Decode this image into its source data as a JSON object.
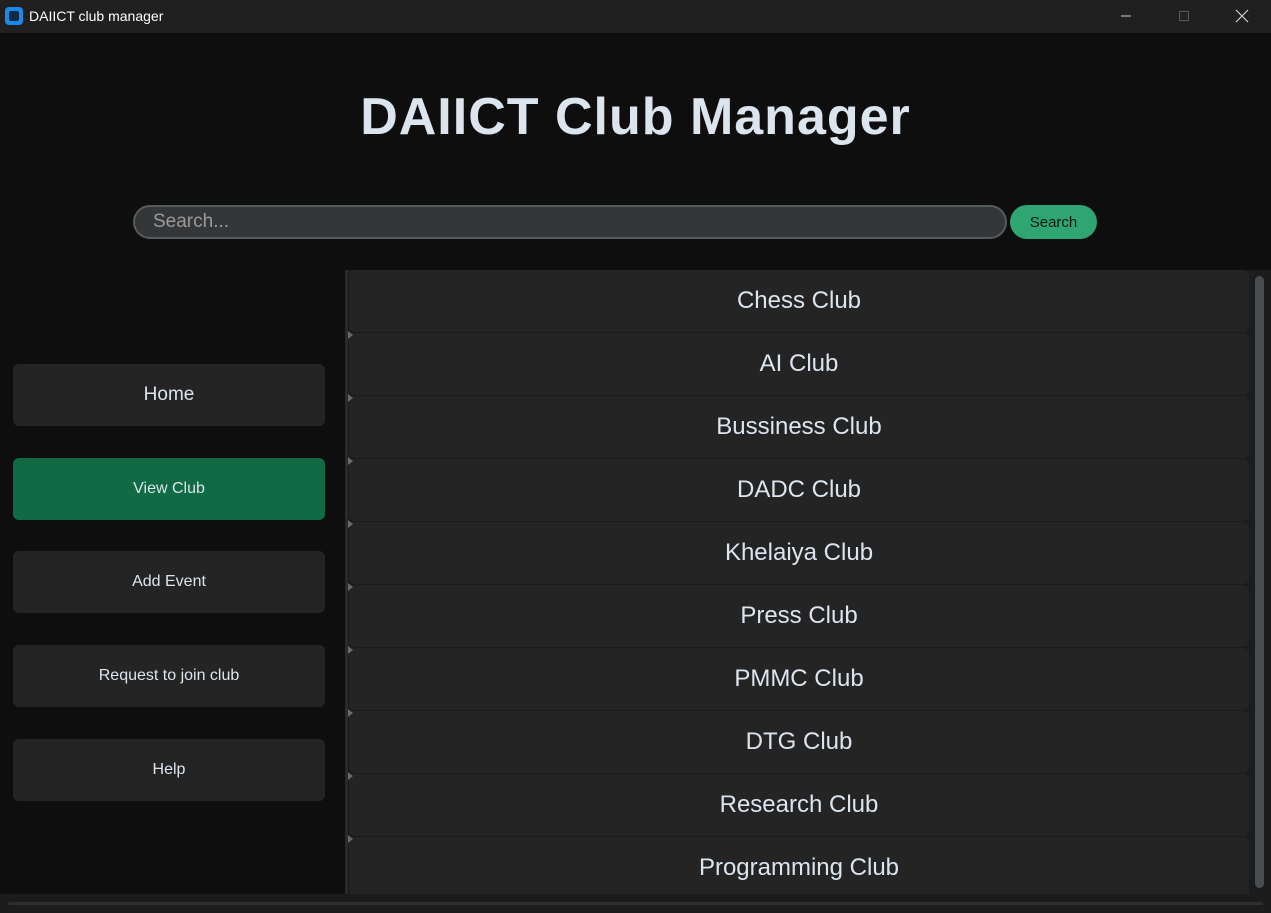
{
  "window": {
    "title": "DAIICT club manager"
  },
  "heading": "DAIICT Club Manager",
  "search": {
    "placeholder": "Search...",
    "value": "",
    "button_label": "Search"
  },
  "sidebar": {
    "items": [
      {
        "label": "Home",
        "active": false
      },
      {
        "label": "View Club",
        "active": true
      },
      {
        "label": "Add Event",
        "active": false
      },
      {
        "label": "Request to join club",
        "active": false
      },
      {
        "label": "Help",
        "active": false
      }
    ]
  },
  "clubs": [
    "Chess Club",
    "AI Club",
    "Bussiness Club",
    "DADC Club",
    "Khelaiya Club",
    "Press Club",
    "PMMC Club",
    "DTG Club",
    "Research Club",
    "Programming Club"
  ],
  "colors": {
    "accent": "#2fa572",
    "active_nav": "#106a43",
    "background": "#0e0e0e",
    "row": "#242424",
    "text": "#dce4ee"
  }
}
